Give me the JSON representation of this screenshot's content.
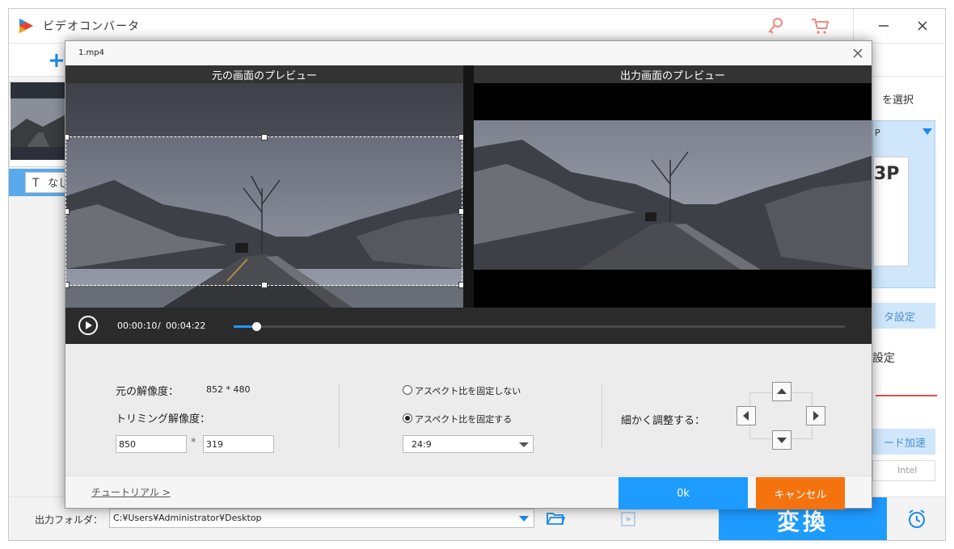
{
  "app": {
    "title": "ビデオコンバータ"
  },
  "toolbar": {
    "add_label": "+"
  },
  "file_list": {
    "subtitle_value": "なし",
    "subtitle_icon_glyph": "T"
  },
  "right_panel": {
    "select_text": "を選択",
    "format_suffix": "P",
    "format_icon_text": "3P",
    "param_settings": "タ設定",
    "settings_heading": "設定",
    "hw_accel": "ード加速",
    "intel_label": "Intel"
  },
  "bottom": {
    "output_label": "出力フォルダ：",
    "output_path": "C:¥Users¥Administrator¥Desktop",
    "convert_label": "変換"
  },
  "dialog": {
    "title": "1.mp4",
    "original_preview_label": "元の画面のプレビュー",
    "output_preview_label": "出力画面のプレビュー",
    "current_time": "00:00:10",
    "time_separator": "/",
    "total_time": "00:04:22",
    "playback_progress": 0.037,
    "original_res_label": "元の解像度：",
    "original_res_value": "852 * 480",
    "trim_res_label": "トリミング解像度：",
    "trim_width": "850",
    "trim_height": "319",
    "multiply_sign": "*",
    "aspect_unlocked_label": "アスペクト比を固定しない",
    "aspect_locked_label": "アスペクト比を固定する",
    "aspect_locked_selected": true,
    "aspect_ratio_value": "24:9",
    "fine_adjust_label": "細かく調整する：",
    "tutorial_link": "チュートリアル >",
    "ok_label": "0k",
    "cancel_label": "キャンセル"
  },
  "colors": {
    "accent_blue": "#1e9bff",
    "cancel_orange": "#f5730f",
    "preview_header": "#333333",
    "player_bar": "#2b2b2b"
  },
  "icons": {
    "app_logo": "app-logo-icon",
    "key": "key-icon",
    "cart": "cart-icon",
    "minimize": "minimize-icon",
    "close": "close-icon",
    "folder": "folder-icon",
    "video_edit": "video-edit-icon",
    "alarm": "alarm-clock-icon",
    "play": "play-icon",
    "arrow_up": "arrow-up-icon",
    "arrow_down": "arrow-down-icon",
    "arrow_left": "arrow-left-icon",
    "arrow_right": "arrow-right-icon",
    "chevron_down": "chevron-down-icon"
  }
}
